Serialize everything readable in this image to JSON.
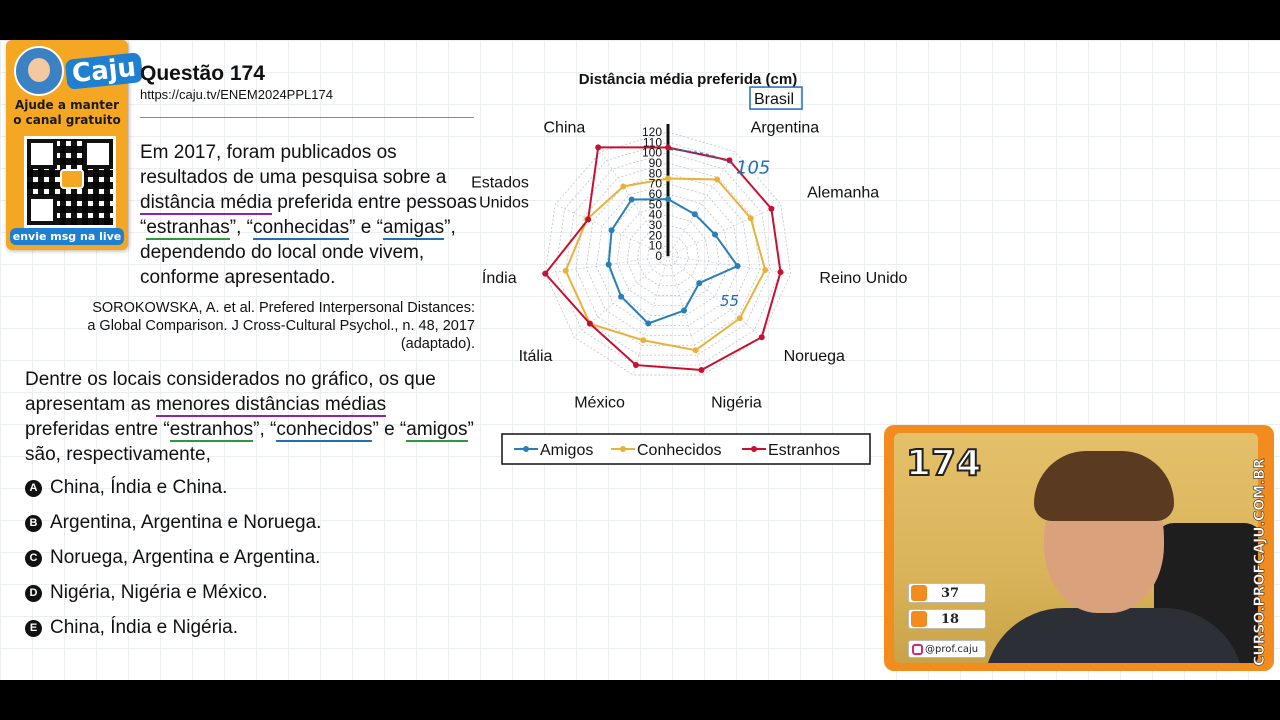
{
  "promo": {
    "logo": "Caju",
    "line1": "Ajude a manter",
    "line2": "o canal gratuito",
    "bottom": "envie msg na live"
  },
  "question": {
    "title": "Questão 174",
    "url": "https://caju.tv/ENEM2024PPL174",
    "para1": {
      "a": "Em 2017, foram publicados os resultados de uma pesquisa sobre a ",
      "b": "distância média",
      "c": " preferida entre pessoas “",
      "d": "estranhas",
      "e": "”, “",
      "f": "conhecidas",
      "g": "” e “",
      "h": "amigas",
      "i": "”, dependendo do local onde vivem, conforme apresentado."
    },
    "source1": "SOROKOWSKA, A. et al. Prefered Interpersonal Distances:",
    "source2": "a Global Comparison. J Cross-Cultural Psychol., n. 48, 2017",
    "source3": "(adaptado).",
    "para2": {
      "a": "Dentre os locais considerados no gráfico, os que apresentam as ",
      "b": "menores distâncias médias",
      "c": " preferidas entre “",
      "d": "estranhos",
      "e": "”, “",
      "f": "conhecidos",
      "g": "” e “",
      "h": "amigos",
      "i": "” são, respectivamente,"
    },
    "options": [
      {
        "letter": "A",
        "text": "China, Índia e China."
      },
      {
        "letter": "B",
        "text": "Argentina, Argentina e Noruega."
      },
      {
        "letter": "C",
        "text": "Noruega, Argentina e Argentina."
      },
      {
        "letter": "D",
        "text": "Nigéria, Nigéria e México."
      },
      {
        "letter": "E",
        "text": "China, Índia e Nigéria."
      }
    ]
  },
  "chart_data": {
    "type": "radar",
    "title": "Distância média preferida (cm)",
    "categories": [
      "Brasil",
      "Argentina",
      "Alemanha",
      "Reino Unido",
      "Noruega",
      "Nigéria",
      "México",
      "Itália",
      "Índia",
      "Estados Unidos",
      "China"
    ],
    "rlim": [
      0,
      120
    ],
    "ticks": [
      "0",
      "10",
      "20",
      "30",
      "40",
      "50",
      "60",
      "70",
      "80",
      "90",
      "100",
      "110",
      "120"
    ],
    "grid": true,
    "legend_position": "bottom",
    "series": [
      {
        "name": "Amigos",
        "color": "#2a7fb8",
        "values": [
          55,
          48,
          50,
          68,
          40,
          55,
          68,
          60,
          58,
          60,
          65
        ]
      },
      {
        "name": "Conhecidos",
        "color": "#e8b23a",
        "values": [
          75,
          88,
          88,
          95,
          92,
          95,
          85,
          100,
          100,
          86,
          80
        ]
      },
      {
        "name": "Estranhos",
        "color": "#c8102e",
        "values": [
          105,
          110,
          110,
          110,
          120,
          115,
          110,
          100,
          120,
          85,
          125
        ]
      }
    ],
    "annotations": [
      "105",
      "55"
    ]
  },
  "webcam": {
    "number": "174",
    "likes": "37",
    "viewers": "18",
    "instagram": "@prof.caju",
    "vertical_text": "CURSO.PROFCAJU.COM.BR"
  }
}
